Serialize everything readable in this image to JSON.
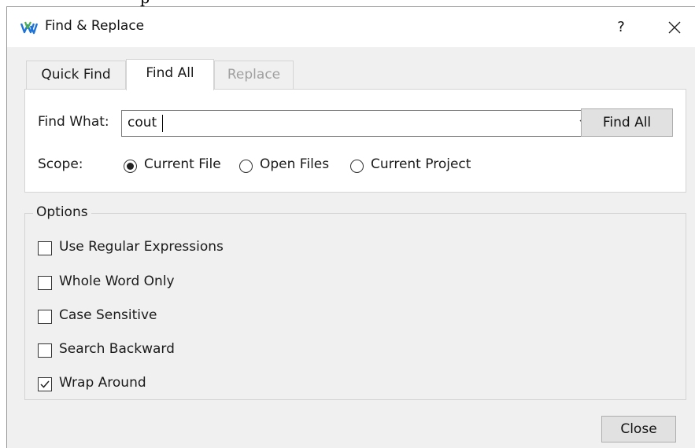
{
  "window": {
    "title": "Find & Replace",
    "help_label": "?"
  },
  "tabs": [
    {
      "label": "Quick Find",
      "state": "normal"
    },
    {
      "label": "Find All",
      "state": "active"
    },
    {
      "label": "Replace",
      "state": "disabled"
    }
  ],
  "find": {
    "label": "Find What:",
    "value": "cout",
    "button_label": "Find All"
  },
  "scope": {
    "label": "Scope:",
    "options": [
      {
        "label": "Current File",
        "checked": true
      },
      {
        "label": "Open Files",
        "checked": false
      },
      {
        "label": "Current Project",
        "checked": false
      }
    ]
  },
  "options": {
    "title": "Options",
    "items": [
      {
        "label": "Use Regular Expressions",
        "checked": false
      },
      {
        "label": "Whole Word Only",
        "checked": false
      },
      {
        "label": "Case Sensitive",
        "checked": false
      },
      {
        "label": "Search Backward",
        "checked": false
      },
      {
        "label": "Wrap Around",
        "checked": true
      }
    ]
  },
  "footer": {
    "close_label": "Close"
  },
  "colors": {
    "icon_blue": "#1e73d8",
    "icon_green": "#4caf50"
  }
}
